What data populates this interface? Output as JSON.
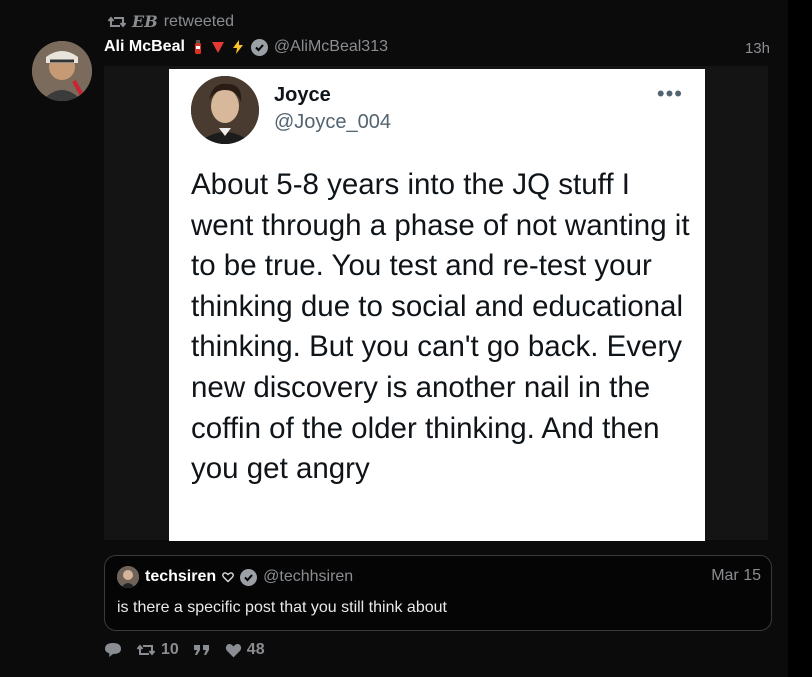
{
  "retweet": {
    "prefix": "EB",
    "label": "retweeted"
  },
  "tweet": {
    "author_name": "Ali McBeal",
    "author_emojis": [
      "fire-extinguisher-icon",
      "red-triangle-icon",
      "lightning-icon"
    ],
    "author_handle": "@AliMcBeal313",
    "time": "13h"
  },
  "embedded_post": {
    "name": "Joyce",
    "handle": "@Joyce_004",
    "more": "•••",
    "text": "About 5-8 years into the JQ stuff I went through a phase of not wanting it to be true. You test and re-test your thinking due to social and educational thinking. But you can't go back. Every new discovery is another nail in the coffin of the older thinking. And then you get angry"
  },
  "quote": {
    "name": "techsiren",
    "handle": "@techhsiren",
    "date": "Mar 15",
    "text": "is there a specific post that you still think about"
  },
  "actions": {
    "retweets": "10",
    "likes": "48"
  },
  "colors": {
    "background": "#000000",
    "muted": "#8a8d91",
    "card": "#ffffff"
  }
}
